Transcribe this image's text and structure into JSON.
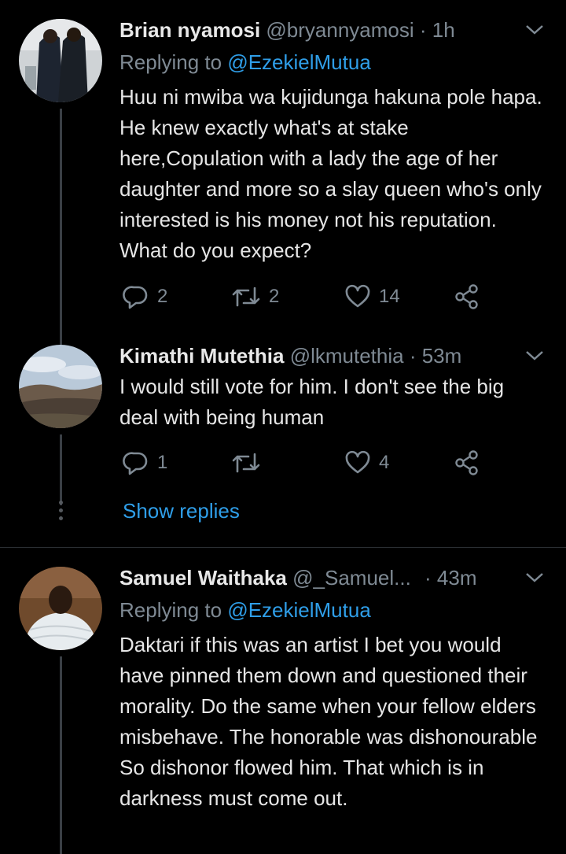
{
  "tweets": [
    {
      "name": "Brian nyamosi",
      "handle": "@bryannyamosi",
      "time": "· 1h",
      "replying_prefix": "Replying to ",
      "replying_to": "@EzekielMutua",
      "text": "Huu ni mwiba wa kujidunga hakuna pole hapa. He knew exactly what's at stake here,Copulation with a lady the age of her daughter and more so a slay queen who's only interested is his money not his reputation. What do you expect?",
      "replies": "2",
      "retweets": "2",
      "likes": "14"
    },
    {
      "name": "Kimathi Mutethia",
      "handle": "@lkmutethia",
      "time": "· 53m",
      "text": "I would still vote for him. I don't see the big deal with being human",
      "replies": "1",
      "retweets": "",
      "likes": "4",
      "show_replies": "Show replies"
    },
    {
      "name": "Samuel Waithaka",
      "handle": "@_Samuel...",
      "time": "· 43m",
      "replying_prefix": "Replying to ",
      "replying_to": "@EzekielMutua",
      "text": "Daktari if this was an artist I bet you would have pinned them down and questioned their morality. Do the same when your fellow elders misbehave. The honorable was dishonourable So dishonor flowed him. That which is in darkness must come out."
    }
  ],
  "colors": {
    "background": "#000000",
    "accent": "#2f9ee8",
    "secondary_text": "#7f8a94",
    "primary_text": "#e6e6e6"
  },
  "icons": [
    "reply-icon",
    "retweet-icon",
    "like-icon",
    "share-icon",
    "chevron-down-icon"
  ]
}
